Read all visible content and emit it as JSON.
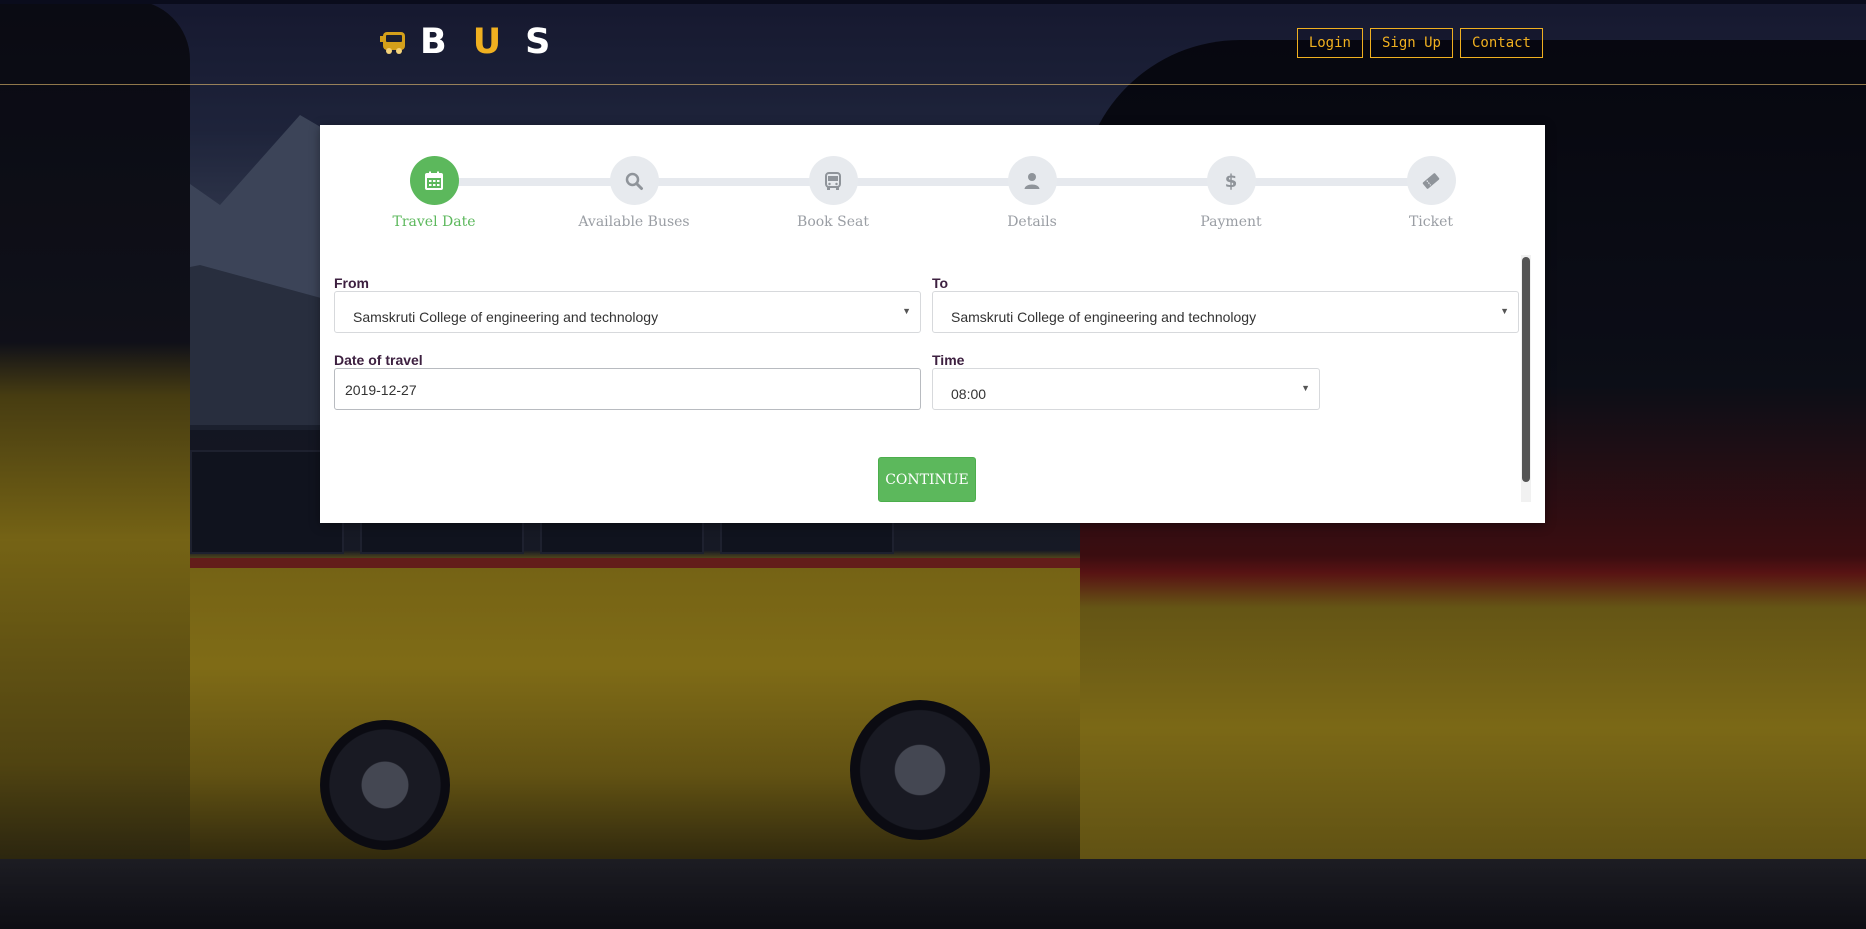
{
  "brand": {
    "letters": [
      "B",
      "U",
      "S"
    ]
  },
  "nav": {
    "login": "Login",
    "signup": "Sign Up",
    "contact": "Contact"
  },
  "steps": [
    {
      "label": "Travel Date",
      "icon": "calendar-icon",
      "active": true
    },
    {
      "label": "Available Buses",
      "icon": "search-icon",
      "active": false
    },
    {
      "label": "Book Seat",
      "icon": "bus-icon",
      "active": false
    },
    {
      "label": "Details",
      "icon": "user-icon",
      "active": false
    },
    {
      "label": "Payment",
      "icon": "dollar-icon",
      "active": false
    },
    {
      "label": "Ticket",
      "icon": "ticket-icon",
      "active": false
    }
  ],
  "form": {
    "from_label": "From",
    "from_value": "Samskruti College of engineering and technology",
    "to_label": "To",
    "to_value": "Samskruti College of engineering and technology",
    "date_label": "Date of travel",
    "date_value": "2019-12-27",
    "time_label": "Time",
    "time_value": "08:00"
  },
  "continue_label": "CONTINUE",
  "colors": {
    "accent": "#5cb85c",
    "brand_gold": "#f0b020",
    "label": "#3d2040"
  }
}
